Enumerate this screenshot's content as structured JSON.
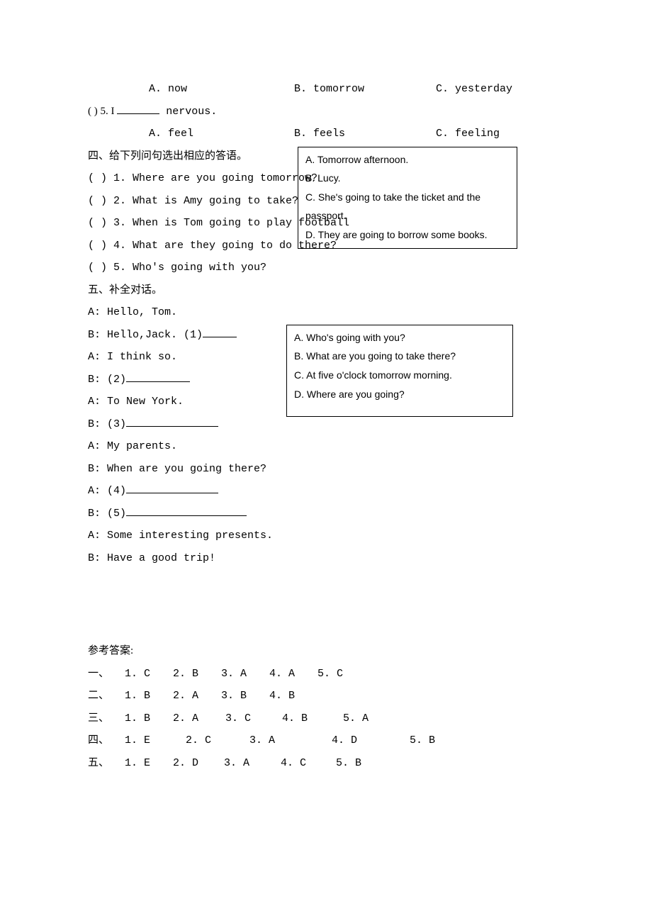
{
  "q4opts": {
    "a": "A. now",
    "b": "B. tomorrow",
    "c": "C. yesterday"
  },
  "q5": {
    "label": "(    ) 5. I ",
    "tail": " nervous.",
    "a": "A. feel",
    "b": "B. feels",
    "c": "C. feeling"
  },
  "sec4": {
    "title": "四、给下列问句选出相应的答语。",
    "q1": "(    ) 1. Where are you going tomorrow?",
    "q2": "(    ) 2. What is Amy going to take?",
    "q3": "(    ) 3. When is Tom going to play football",
    "q4": "(    ) 4. What are they going to do there?",
    "q5": "(    ) 5. Who's going with you?",
    "boxA": "A. Tomorrow afternoon.",
    "boxB": "B. Lucy.",
    "boxC": "C. She's going to take the ticket and the passport.",
    "boxD": "D. They are going to borrow some books."
  },
  "sec5": {
    "title": "五、补全对话。",
    "l1": "A:  Hello, Tom.",
    "l2a": "B: Hello,Jack. (1)",
    "l3": "A: I think so.",
    "l4a": "B: (2)",
    "l5": "A: To New York.",
    "l6a": "B: (3)",
    "l7": "A: My parents.",
    "l8": "B:  When are you going there?",
    "l9a": "A: (4)",
    "l10a": "B: (5)",
    "l11": "A: Some interesting presents.",
    "l12": "B: Have a good trip!",
    "boxA": "A. Who's going with you?",
    "boxB": "B. What are you going to take there?",
    "boxC": "C. At five o'clock tomorrow morning.",
    "boxD": "D. Where are you going?"
  },
  "answers": {
    "title": "参考答案:",
    "r1": {
      "n": "一、",
      "i1": "1. C",
      "i2": "2. B",
      "i3": "3. A",
      "i4": "4. A",
      "i5": "5. C"
    },
    "r2": {
      "n": "二、",
      "i1": "1. B",
      "i2": "2. A",
      "i3": "3. B",
      "i4": "4. B"
    },
    "r3": {
      "n": "三、",
      "i1": "1. B",
      "i2": "2. A",
      "i3": "3. C",
      "i4": "4. B",
      "i5": "5. A"
    },
    "r4": {
      "n": "四、",
      "i1": "1. E",
      "i2": "2. C",
      "i3": "3. A",
      "i4": "4. D",
      "i5": "5. B"
    },
    "r5": {
      "n": "五、",
      "i1": "1. E",
      "i2": "2. D",
      "i3": "3. A",
      "i4": "4. C",
      "i5": "5. B"
    }
  }
}
